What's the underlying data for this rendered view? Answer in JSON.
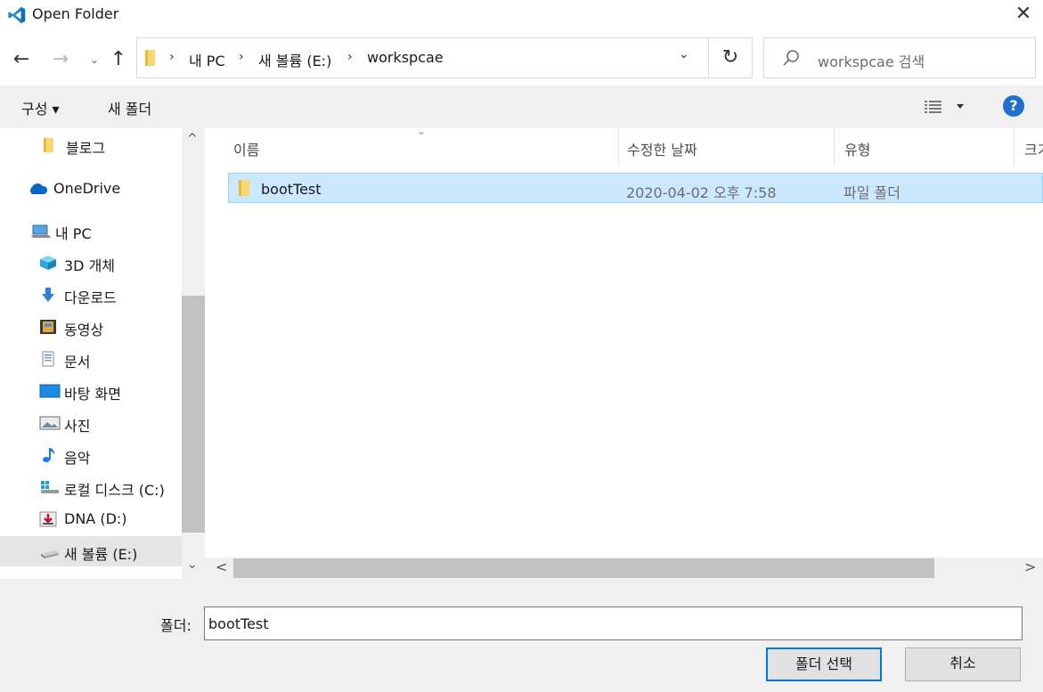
{
  "window": {
    "title": "Open Folder",
    "close_glyph": "✕",
    "app_icon": "vscode-icon"
  },
  "nav_buttons": {
    "back": "←",
    "forward": "→",
    "recent": "⌄",
    "up": "↑"
  },
  "address": {
    "crumbs": [
      "내 PC",
      "새 볼륨 (E:)",
      "workspcae"
    ],
    "separator": "›",
    "dropdown": "⌄",
    "refresh": "↻"
  },
  "search": {
    "placeholder": "workspcae 검색"
  },
  "toolbar": {
    "organize": "구성 ▾",
    "new_folder": "새 폴더",
    "help": "?"
  },
  "nav_pane": {
    "items": [
      {
        "label": "블로그",
        "icon": "folder-icon"
      },
      {
        "label": "OneDrive",
        "icon": "cloud-icon"
      },
      {
        "label": "내 PC",
        "icon": "computer-icon"
      },
      {
        "label": "3D 개체",
        "icon": "cube-icon"
      },
      {
        "label": "다운로드",
        "icon": "download-icon"
      },
      {
        "label": "동영상",
        "icon": "video-icon"
      },
      {
        "label": "문서",
        "icon": "document-icon"
      },
      {
        "label": "바탕 화면",
        "icon": "desktop-icon"
      },
      {
        "label": "사진",
        "icon": "picture-icon"
      },
      {
        "label": "음악",
        "icon": "music-icon"
      },
      {
        "label": "로컬 디스크 (C:)",
        "icon": "windows-drive-icon"
      },
      {
        "label": "DNA (D:)",
        "icon": "removable-drive-icon"
      },
      {
        "label": "새 볼륨 (E:)",
        "icon": "drive-icon",
        "selected": true
      }
    ],
    "scroll_up": "^",
    "scroll_down": "⌄"
  },
  "columns": [
    "이름",
    "수정한 날짜",
    "유형",
    "크기"
  ],
  "files": [
    {
      "name": "bootTest",
      "modified": "2020-04-02 오후 7:58",
      "type": "파일 폴더",
      "selected": true
    }
  ],
  "hscroll": {
    "left": "<",
    "right": ">"
  },
  "bottom": {
    "folder_label": "폴더:",
    "folder_value": "bootTest",
    "select_button": "폴더 선택",
    "cancel_button": "취소"
  },
  "colors": {
    "accent": "#0078d7",
    "selection": "#cce8ff",
    "vscode_blue": "#2489ca",
    "folder_yellow": "#f8d775"
  }
}
